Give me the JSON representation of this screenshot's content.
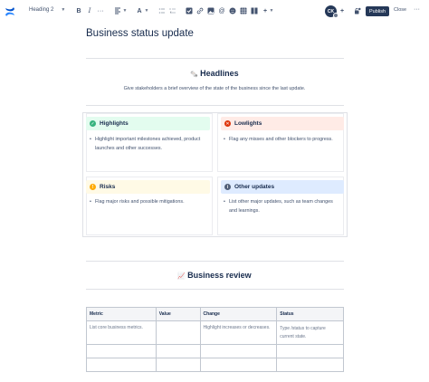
{
  "toolbar": {
    "heading_style": "Heading 2",
    "more_label": "···",
    "avatar_initials": "CK",
    "publish_label": "Publish",
    "close_label": "Close",
    "overflow_label": "···"
  },
  "page": {
    "title": "Business status update"
  },
  "headlines": {
    "heading": "Headlines",
    "intro": "Give stakeholders a brief overview of the state of the business since the last update."
  },
  "panels": {
    "highlights": {
      "title": "Highlights",
      "items": [
        "Highlight important milestones achieved, product launches and other successes."
      ],
      "color": "#e3fcef",
      "icon_color": "#36b37e"
    },
    "lowlights": {
      "title": "Lowlights",
      "items": [
        "Flag any misses and other blockers to progress."
      ],
      "color": "#ffebe6",
      "icon_color": "#de350b"
    },
    "risks": {
      "title": "Risks",
      "items": [
        "Flag major risks and possible mitigations."
      ],
      "color": "#fffae6",
      "icon_color": "#ffab00"
    },
    "other_updates": {
      "title": "Other updates",
      "items": [
        "List other major updates, such as team changes and learnings."
      ],
      "color": "#deebff",
      "icon_color": "#505f79"
    }
  },
  "business_review": {
    "heading": "Business review",
    "table": {
      "headers": [
        "Metric",
        "Value",
        "Change",
        "Status"
      ],
      "rows": [
        [
          "List core business metrics.",
          "",
          "Highlight increases or decreases.",
          "Type /status to capture current state."
        ],
        [
          "",
          "",
          "",
          ""
        ],
        [
          "",
          "",
          "",
          ""
        ]
      ]
    }
  }
}
